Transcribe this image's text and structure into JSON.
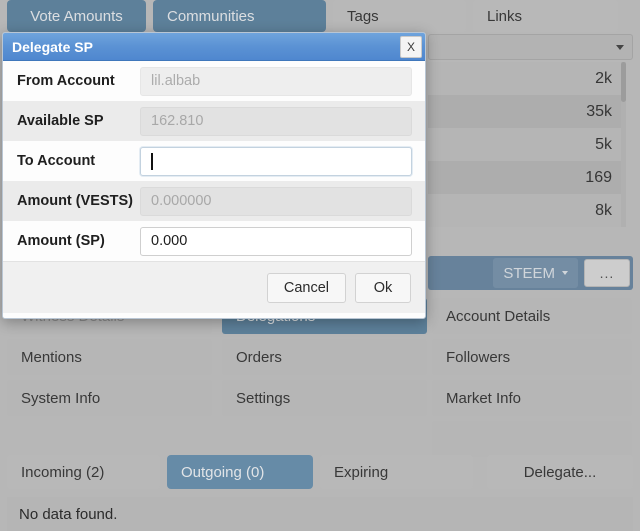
{
  "top_tabs": [
    {
      "label": "Vote Amounts",
      "selected": true
    },
    {
      "label": "Communities",
      "selected": true
    },
    {
      "label": "Tags",
      "selected": false
    },
    {
      "label": "Links",
      "selected": false
    }
  ],
  "combobox": {
    "value": "",
    "caret_icon": "chevron-down-icon"
  },
  "value_list": [
    "2k",
    "35k",
    "5k",
    "169",
    "8k"
  ],
  "action_bar": {
    "currency_label": "STEEM",
    "currency_caret_icon": "chevron-down-icon",
    "more_label": "..."
  },
  "right_menu": [
    "Account Details",
    "Followers",
    "Market Info",
    ""
  ],
  "left_grid": [
    {
      "label": "Witness Details",
      "state": "disabled"
    },
    {
      "label": "Delegations",
      "state": "selected"
    },
    {
      "label": "Mentions",
      "state": "normal"
    },
    {
      "label": "Orders",
      "state": "normal"
    },
    {
      "label": "System Info",
      "state": "normal"
    },
    {
      "label": "Settings",
      "state": "normal"
    }
  ],
  "bottom_tabs": [
    {
      "label": "Incoming (2)",
      "selected": false
    },
    {
      "label": "Outgoing (0)",
      "selected": true
    },
    {
      "label": "Expiring",
      "selected": false
    },
    {
      "label": "Delegate...",
      "selected": false
    }
  ],
  "status_text": "No data found.",
  "dialog": {
    "title": "Delegate SP",
    "close_label": "X",
    "fields": [
      {
        "label": "From Account",
        "value": "lil.albab",
        "state": "disabled"
      },
      {
        "label": "Available SP",
        "value": "162.810",
        "state": "disabled"
      },
      {
        "label": "To Account",
        "value": "",
        "state": "focused"
      },
      {
        "label": "Amount (VESTS)",
        "value": "0.000000",
        "state": "disabled"
      },
      {
        "label": "Amount (SP)",
        "value": "0.000",
        "state": "active"
      }
    ],
    "cancel_label": "Cancel",
    "ok_label": "Ok"
  },
  "colors": {
    "accent_blue": "#4a8ec2",
    "title_blue": "#5b92d4",
    "window_grey": "#b7b7b7",
    "panel_grey": "#c4c4c4"
  }
}
